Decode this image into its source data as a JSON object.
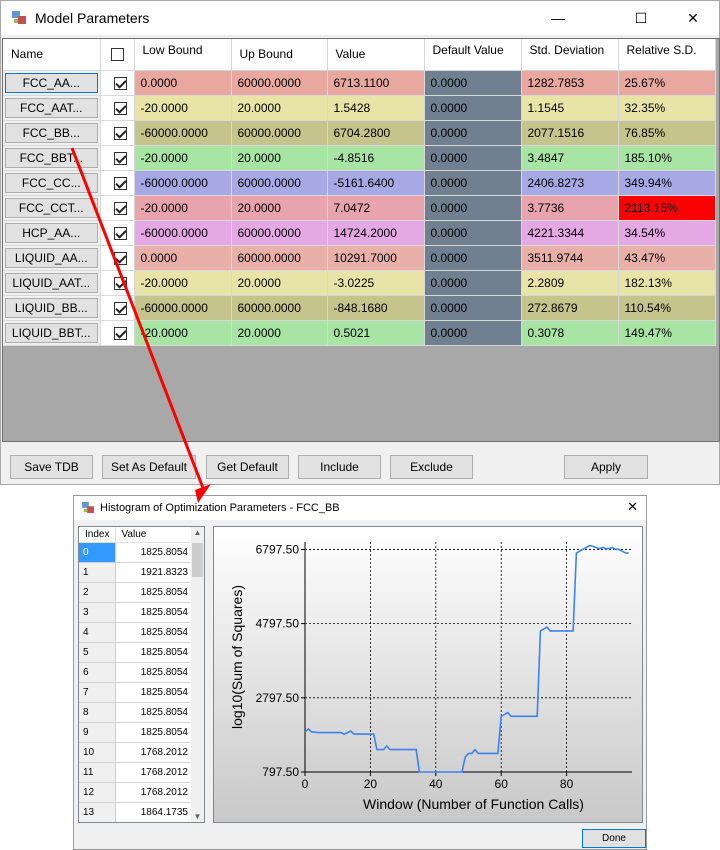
{
  "main_window": {
    "title": "Model Parameters",
    "controls": {
      "minimize": "—",
      "maximize": "☐",
      "close": "✕"
    },
    "columns": [
      "Name",
      "",
      "Low Bound",
      "Up Bound",
      "Value",
      "Default Value",
      "Std. Deviation",
      "Relative S.D."
    ],
    "rows": [
      {
        "name": "FCC_AA...",
        "checked": true,
        "low": "0.0000",
        "up": "60000.0000",
        "value": "6713.1100",
        "default": "0.0000",
        "sd": "1282.7853",
        "rsd": "25.67%",
        "color": "#e8a8a0"
      },
      {
        "name": "FCC_AAT...",
        "checked": true,
        "low": "-20.0000",
        "up": "20.0000",
        "value": "1.5428",
        "default": "0.0000",
        "sd": "1.1545",
        "rsd": "32.35%",
        "color": "#e8e4a8"
      },
      {
        "name": "FCC_BB...",
        "checked": true,
        "low": "-60000.0000",
        "up": "60000.0000",
        "value": "6704.2800",
        "default": "0.0000",
        "sd": "2077.1516",
        "rsd": "76.85%",
        "color": "#c4c48c"
      },
      {
        "name": "FCC_BBT...",
        "checked": true,
        "low": "-20.0000",
        "up": "20.0000",
        "value": "-4.8516",
        "default": "0.0000",
        "sd": "3.4847",
        "rsd": "185.10%",
        "color": "#a8e4a4"
      },
      {
        "name": "FCC_CC...",
        "checked": true,
        "low": "-60000.0000",
        "up": "60000.0000",
        "value": "-5161.6400",
        "default": "0.0000",
        "sd": "2406.8273",
        "rsd": "349.94%",
        "color": "#a8a8e4"
      },
      {
        "name": "FCC_CCT...",
        "checked": true,
        "low": "-20.0000",
        "up": "20.0000",
        "value": "7.0472",
        "default": "0.0000",
        "sd": "3.7736",
        "rsd": "2113.15%",
        "color": "#e8a4ac",
        "rsd_color": "#ff0000"
      },
      {
        "name": "HCP_AA...",
        "checked": true,
        "low": "-60000.0000",
        "up": "60000.0000",
        "value": "14724.2000",
        "default": "0.0000",
        "sd": "4221.3344",
        "rsd": "34.54%",
        "color": "#e4a8e4"
      },
      {
        "name": "LIQUID_AA...",
        "checked": true,
        "low": "0.0000",
        "up": "60000.0000",
        "value": "10291.7000",
        "default": "0.0000",
        "sd": "3511.9744",
        "rsd": "43.47%",
        "color": "#e8b0a8"
      },
      {
        "name": "LIQUID_AAT...",
        "checked": true,
        "low": "-20.0000",
        "up": "20.0000",
        "value": "-3.0225",
        "default": "0.0000",
        "sd": "2.2809",
        "rsd": "182.13%",
        "color": "#e8e4a8"
      },
      {
        "name": "LIQUID_BB...",
        "checked": true,
        "low": "-60000.0000",
        "up": "60000.0000",
        "value": "-848.1680",
        "default": "0.0000",
        "sd": "272.8679",
        "rsd": "110.54%",
        "color": "#c4c48c"
      },
      {
        "name": "LIQUID_BBT...",
        "checked": true,
        "low": "-20.0000",
        "up": "20.0000",
        "value": "0.5021",
        "default": "0.0000",
        "sd": "0.3078",
        "rsd": "149.47%",
        "color": "#a8e4a4"
      }
    ],
    "buttons": {
      "save_tdb": "Save TDB",
      "set_default": "Set As Default",
      "get_default": "Get Default",
      "include": "Include",
      "exclude": "Exclude",
      "apply": "Apply"
    }
  },
  "histogram_window": {
    "title": "Histogram of Optimization Parameters - FCC_BB",
    "close": "✕",
    "list_headers": {
      "index": "Index",
      "value": "Value"
    },
    "list": [
      {
        "index": "0",
        "value": "1825.8054"
      },
      {
        "index": "1",
        "value": "1921.8323"
      },
      {
        "index": "2",
        "value": "1825.8054"
      },
      {
        "index": "3",
        "value": "1825.8054"
      },
      {
        "index": "4",
        "value": "1825.8054"
      },
      {
        "index": "5",
        "value": "1825.8054"
      },
      {
        "index": "6",
        "value": "1825.8054"
      },
      {
        "index": "7",
        "value": "1825.8054"
      },
      {
        "index": "8",
        "value": "1825.8054"
      },
      {
        "index": "9",
        "value": "1825.8054"
      },
      {
        "index": "10",
        "value": "1768.2012"
      },
      {
        "index": "11",
        "value": "1768.2012"
      },
      {
        "index": "12",
        "value": "1768.2012"
      },
      {
        "index": "13",
        "value": "1864.1735"
      }
    ],
    "done_label": "Done"
  },
  "chart_data": {
    "type": "line",
    "title": "",
    "xlabel": "Window (Number of Function Calls)",
    "ylabel": "log10(Sum of Squares)",
    "xlim": [
      0,
      100
    ],
    "ylim": [
      797.5,
      6997.5
    ],
    "xticks": [
      0,
      20,
      40,
      60,
      80
    ],
    "yticks": [
      797.5,
      2797.5,
      4797.5,
      6797.5
    ],
    "ytick_labels": [
      "797.50",
      "2797.50",
      "4797.50",
      "6797.50"
    ],
    "grid": true,
    "series_color": "#3c82f0",
    "x": [
      0,
      1,
      2,
      4,
      11,
      12,
      13,
      14,
      15,
      21,
      22,
      24,
      25,
      26,
      27,
      29,
      34,
      35,
      36,
      39,
      40,
      41,
      47,
      48,
      49,
      50,
      51,
      52,
      53,
      54,
      59,
      60,
      61,
      62,
      63,
      64,
      65,
      66,
      71,
      72,
      73,
      74,
      75,
      82,
      83,
      84,
      85,
      86,
      87,
      88,
      89,
      90,
      91,
      92,
      93,
      94,
      95,
      96,
      97,
      98,
      99
    ],
    "y": [
      1880,
      1960,
      1880,
      1860,
      1860,
      1820,
      1860,
      1900,
      1820,
      1820,
      1400,
      1400,
      1500,
      1400,
      1400,
      1400,
      1400,
      797.5,
      797.5,
      797.5,
      797.5,
      797.5,
      797.5,
      797.5,
      1200,
      1300,
      1300,
      1400,
      1300,
      1300,
      1300,
      2300,
      2350,
      2400,
      2300,
      2300,
      2300,
      2300,
      2300,
      4600,
      4650,
      4700,
      4600,
      4600,
      6700,
      6750,
      6800,
      6850,
      6900,
      6880,
      6850,
      6820,
      6850,
      6820,
      6820,
      6850,
      6800,
      6800,
      6750,
      6700,
      6700
    ]
  }
}
